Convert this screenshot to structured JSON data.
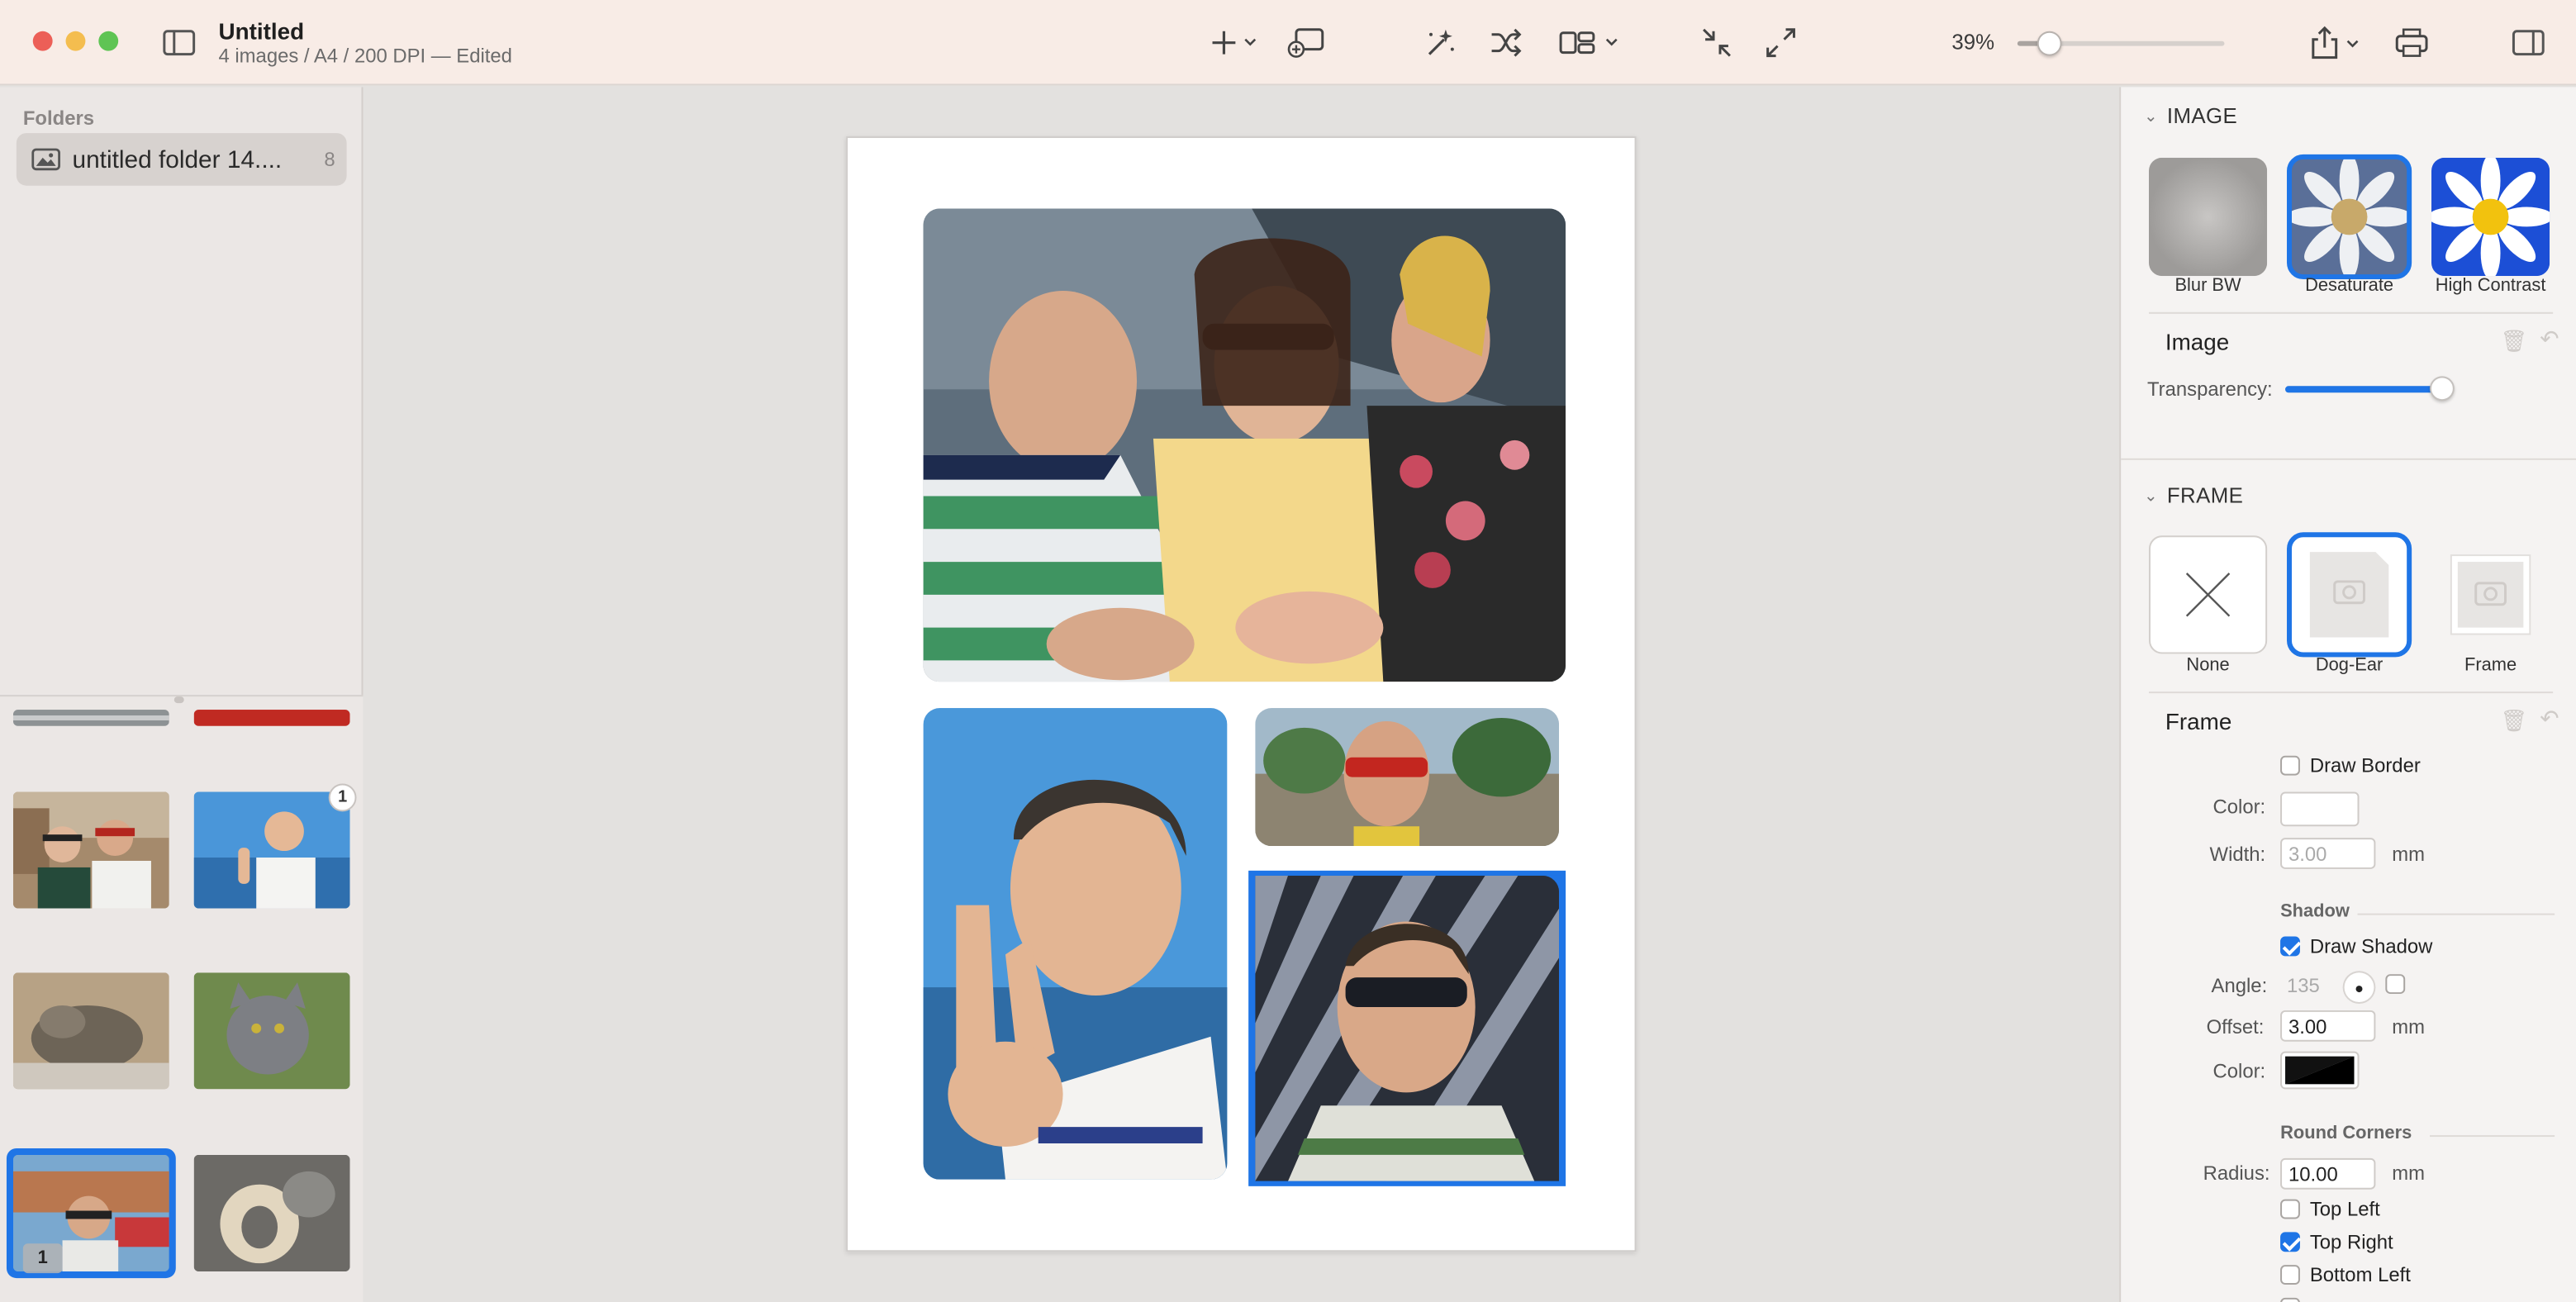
{
  "window": {
    "title": "Untitled",
    "subtitle": "4 images / A4 / 200 DPI — Edited",
    "zoom": "39%",
    "zoom_fraction": 0.15
  },
  "toolbar": {
    "icons": [
      "sidebar-icon",
      "add-icon",
      "add-page-icon",
      "magic-wand-icon",
      "shuffle-icon",
      "layout-icon",
      "shrink-icon",
      "expand-icon",
      "share-icon",
      "print-icon",
      "inspector-icon"
    ]
  },
  "sidebar": {
    "header": "Folders",
    "folder": {
      "label": "untitled folder 14....",
      "count": "8"
    },
    "thumbnails": [
      {
        "badge": ""
      },
      {
        "badge": "1"
      },
      {
        "badge": ""
      },
      {
        "badge": ""
      },
      {
        "badge": "1"
      },
      {
        "badge": ""
      }
    ]
  },
  "inspector": {
    "image_section": {
      "header": "IMAGE",
      "presets": [
        "Blur BW",
        "Desaturate",
        "High Contrast"
      ],
      "selected": "Desaturate",
      "subheader": "Image",
      "transparency_label": "Transparency:",
      "transparency_value": 0.95
    },
    "frame_section": {
      "header": "FRAME",
      "presets": [
        "None",
        "Dog-Ear",
        "Frame"
      ],
      "selected": "Dog-Ear",
      "subheader": "Frame",
      "draw_border_label": "Draw Border",
      "draw_border": false,
      "color_label": "Color:",
      "width_label": "Width:",
      "width_value": "3.00",
      "unit": "mm",
      "shadow_header": "Shadow",
      "draw_shadow_label": "Draw Shadow",
      "draw_shadow": true,
      "angle_label": "Angle:",
      "angle_value": "135",
      "offset_label": "Offset:",
      "offset_value": "3.00",
      "shadow_color_label": "Color:",
      "round_corners_header": "Round Corners",
      "radius_label": "Radius:",
      "radius_value": "10.00",
      "top_left_label": "Top Left",
      "top_left": false,
      "top_right_label": "Top Right",
      "top_right": true,
      "bottom_left_label": "Bottom Left",
      "bottom_left": false
    }
  },
  "colors": {
    "accent": "#1f75e6",
    "titlebar": "#f8ece6",
    "close": "#ec5f57",
    "minimize": "#f4bd4f",
    "zoom": "#5fc454"
  }
}
